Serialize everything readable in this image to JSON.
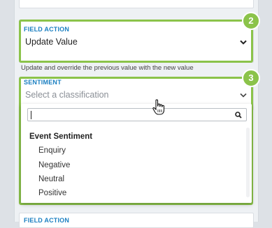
{
  "field_action_1": {
    "label": "FIELD ACTION",
    "value": "Update Value",
    "helper": "Update and override the previous value with the new value",
    "step": "2"
  },
  "sentiment": {
    "label": "SENTIMENT",
    "placeholder": "Select a classification",
    "step": "3",
    "dropdown": {
      "search_value": "",
      "group_title": "Event Sentiment",
      "options": [
        "Enquiry",
        "Negative",
        "Neutral",
        "Positive"
      ]
    }
  },
  "field_action_2": {
    "label": "FIELD ACTION"
  },
  "icons": {
    "chevron": "chevron-down-icon",
    "search": "search-icon",
    "cursor": "hand-pointer-icon"
  },
  "colors": {
    "accent_label": "#1a7fc1",
    "highlight": "#8bc34a"
  }
}
